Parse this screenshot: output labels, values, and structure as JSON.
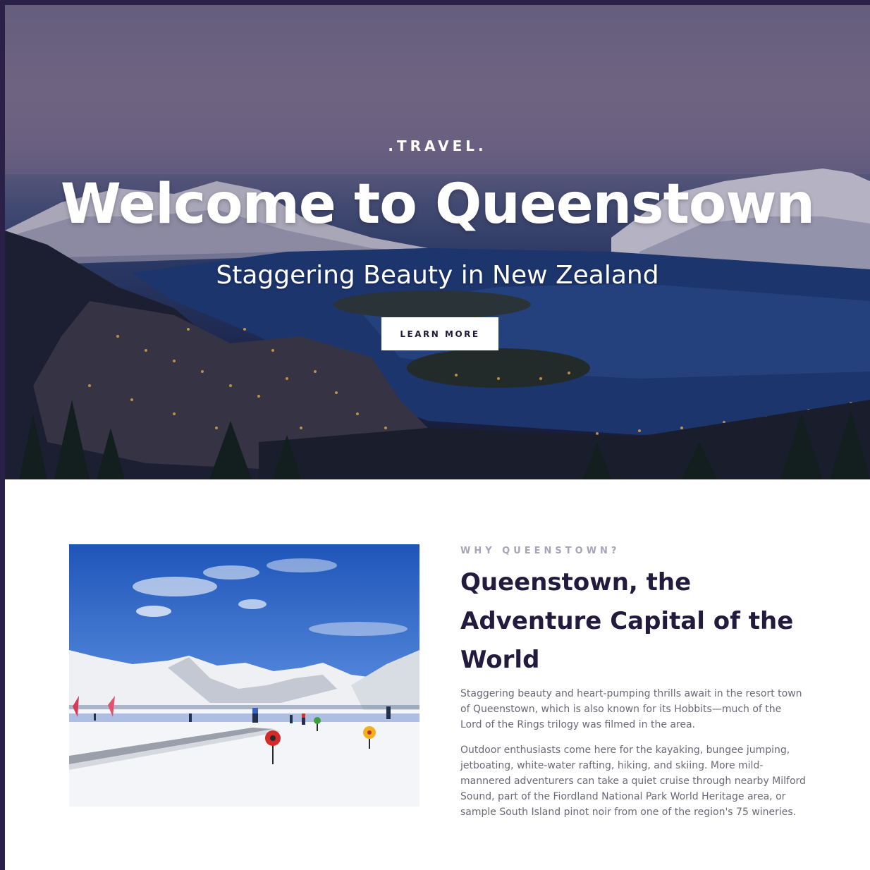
{
  "hero": {
    "eyebrow": ".TRAVEL.",
    "title": "Welcome to Queenstown",
    "subtitle": "Staggering Beauty in New Zealand",
    "cta_label": "LEARN MORE"
  },
  "intro": {
    "eyebrow": "WHY QUEENSTOWN?",
    "title": "Queenstown, the Adventure Capital of the World",
    "paragraphs": [
      "Staggering beauty and heart-pumping thrills await in the resort town of Queenstown, which is also known for its Hobbits—much of the Lord of the Rings trilogy was filmed in the area.",
      "Outdoor enthusiasts come here for the kayaking, bungee jumping, jetboating, white-water rafting, hiking, and skiing. More mild-mannered adventurers can take a quiet cruise through nearby Milford Sound, part of the Fiordland National Park World Heritage area, or sample South Island pinot noir from one of the region's 75 wineries."
    ]
  },
  "colors": {
    "page_border": "#2a2048",
    "heading": "#231b3d",
    "body_text": "#6b6877",
    "eyebrow_muted": "#a8a4b8",
    "button_bg": "#ffffff"
  }
}
